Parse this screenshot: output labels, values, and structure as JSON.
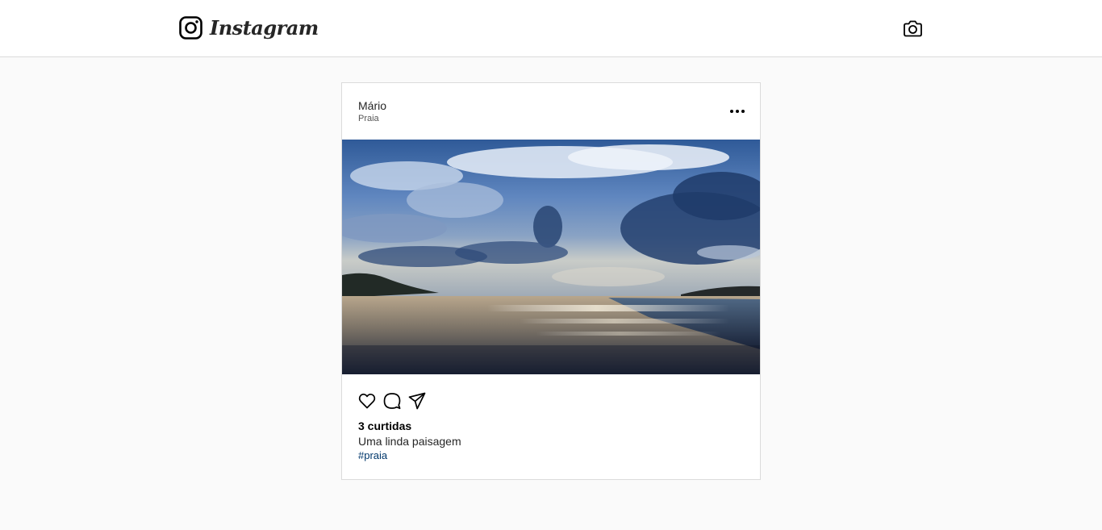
{
  "header": {
    "brand": "Instagram",
    "logo_icon": "instagram-glyph-icon",
    "camera_icon": "camera-icon"
  },
  "post": {
    "username": "Mário",
    "location": "Praia",
    "more_icon": "more-options-icon",
    "image_subject": "beach-photo",
    "actions": {
      "like_icon": "heart-icon",
      "comment_icon": "comment-icon",
      "share_icon": "paper-plane-icon"
    },
    "likes": "3 curtidas",
    "caption": "Uma linda paisagem",
    "hashtag": "#praia"
  },
  "colors": {
    "page_bg": "#fafafa",
    "card_bg": "#ffffff",
    "border": "#dbdbdb",
    "text": "#262626",
    "hashtag": "#00376b"
  }
}
